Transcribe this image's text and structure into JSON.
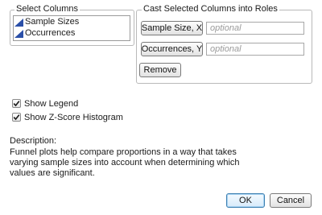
{
  "select_columns": {
    "title": "Select Columns",
    "items": [
      {
        "label": "Sample Sizes",
        "icon": "continuous-column-icon"
      },
      {
        "label": "Occurrences",
        "icon": "continuous-column-icon"
      }
    ]
  },
  "cast_roles": {
    "title": "Cast Selected Columns into Roles",
    "roles": [
      {
        "button_label": "Sample Size, X",
        "placeholder": "optional"
      },
      {
        "button_label": "Occurrences, Y",
        "placeholder": "optional"
      }
    ],
    "remove_label": "Remove"
  },
  "options": {
    "show_legend": {
      "label": "Show Legend",
      "checked": true
    },
    "show_zscore": {
      "label": "Show Z-Score Histogram",
      "checked": true
    }
  },
  "description": {
    "label": "Description:",
    "text": "Funnel plots help compare proportions in a way that takes varying sample sizes into account when determining which values are significant."
  },
  "buttons": {
    "ok_label": "OK",
    "cancel_label": "Cancel"
  },
  "colors": {
    "column_icon": "#2a4fa8",
    "default_button_border": "#3c7fb1"
  }
}
